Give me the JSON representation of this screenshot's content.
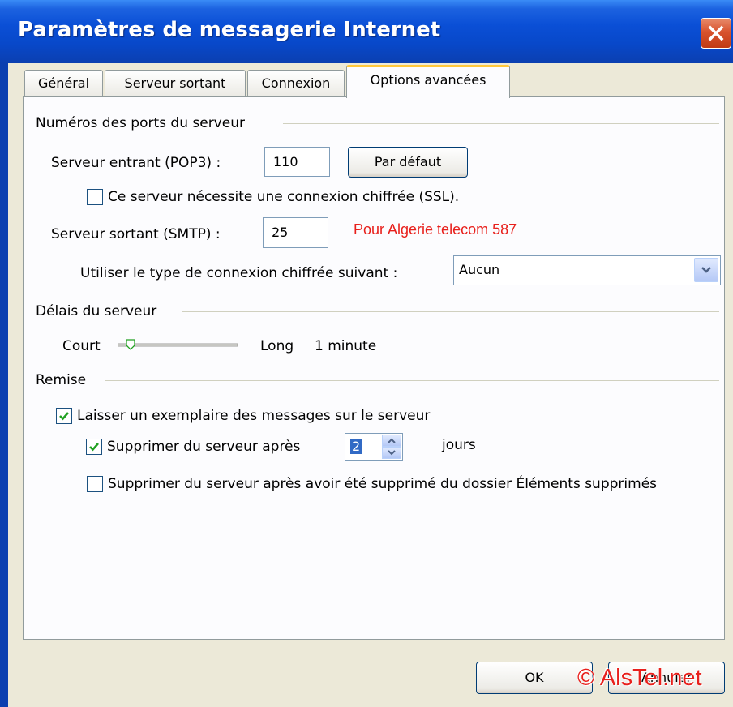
{
  "window": {
    "title": "Paramètres de messagerie Internet"
  },
  "tabs": [
    {
      "label": "Général",
      "active": false
    },
    {
      "label": "Serveur sortant",
      "active": false
    },
    {
      "label": "Connexion",
      "active": false
    },
    {
      "label": "Options avancées",
      "active": true
    }
  ],
  "ports": {
    "group_label": "Numéros des ports du serveur",
    "incoming_label": "Serveur entrant (POP3) :",
    "incoming_value": "110",
    "default_button": "Par défaut",
    "ssl_label": "Ce serveur nécessite une connexion chiffrée (SSL).",
    "ssl_checked": false,
    "outgoing_label": "Serveur sortant (SMTP) :",
    "outgoing_value": "25",
    "annotation": "Pour Algerie telecom 587",
    "encryption_label": "Utiliser le type de connexion chiffrée suivant :",
    "encryption_value": "Aucun"
  },
  "timeouts": {
    "group_label": "Délais du serveur",
    "short_label": "Court",
    "long_label": "Long",
    "value_text": "1 minute",
    "slider_fraction": 0.08
  },
  "delivery": {
    "group_label": "Remise",
    "leave_copy_label": "Laisser un exemplaire des messages sur le serveur",
    "leave_copy_checked": true,
    "remove_after_label": "Supprimer du serveur après",
    "remove_after_checked": true,
    "remove_after_days": "2",
    "days_label": "jours",
    "remove_deleted_label": "Supprimer du serveur après avoir été supprimé du dossier Éléments supprimés",
    "remove_deleted_checked": false
  },
  "buttons": {
    "ok": "OK",
    "cancel": "Annuler"
  },
  "watermark": "© AlsTel.net",
  "colors": {
    "annotation": "#e8201c",
    "watermark": "#e8201c",
    "check": "#21a121",
    "title_bar": "#0a4fd6",
    "tab_highlight": "#ffc83c"
  }
}
